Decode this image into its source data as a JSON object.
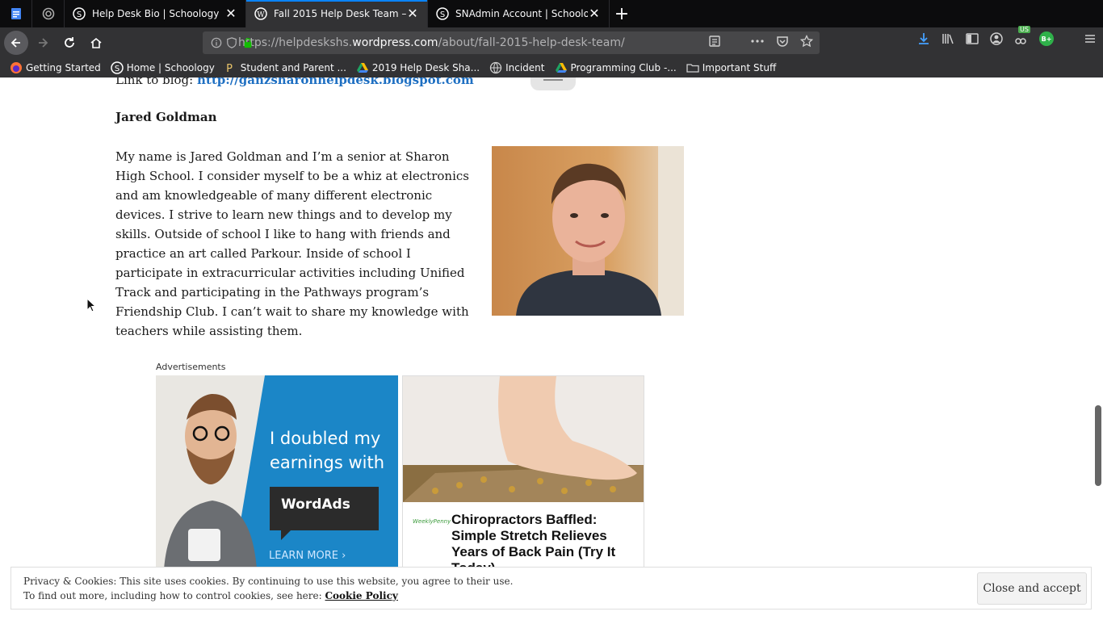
{
  "tabs": [
    {
      "title": "Help Desk Bio | Schoology",
      "active": false
    },
    {
      "title": "Fall 2015 Help Desk Team – SH",
      "active": true
    },
    {
      "title": "SNAdmin Account | Schoology",
      "active": false
    }
  ],
  "url": {
    "prefix": "https://helpdeskshs.",
    "domain": "wordpress.com",
    "path": "/about/fall-2015-help-desk-team/"
  },
  "bookmarks": [
    {
      "label": "Getting Started",
      "icon": "firefox-icon"
    },
    {
      "label": "Home | Schoology",
      "icon": "schoology-icon"
    },
    {
      "label": "Student and Parent ...",
      "icon": "p-icon"
    },
    {
      "label": "2019 Help Desk Sha...",
      "icon": "drive-icon"
    },
    {
      "label": "Incident",
      "icon": "globe-icon"
    },
    {
      "label": "Programming Club -...",
      "icon": "drive-icon"
    },
    {
      "label": "Important Stuff",
      "icon": "folder-icon"
    }
  ],
  "toolbar_badges": {
    "us": "US",
    "bplus": "B+"
  },
  "content": {
    "blog_label": "Link to blog:",
    "blog_url": "http://ganzsharonhelpdesk.blogspot.com",
    "name": "Jared Goldman",
    "bio": "My name is Jared Goldman and I’m a senior at Sharon High School. I consider myself to be a whiz at electronics and am knowledgeable of many different electronic devices. I strive to learn new things and to develop my skills. Outside of school I like to hang with friends and practice an art called Parkour. Inside of school I participate in extracurricular activities including Unified Track and participating in the Pathways program’s Friendship Club. I can’t wait to share my knowledge with teachers while assisting them."
  },
  "ads": {
    "label": "Advertisements",
    "ad1": {
      "text": "I doubled my earnings with",
      "brand": "WordAds",
      "cta": "LEARN MORE ›"
    },
    "ad2": {
      "logo": "WeeklyPenny",
      "headline": "Chiropractors Baffled: Simple Stretch Relieves Years of Back Pain (Try It Today)"
    }
  },
  "cookie": {
    "line1": "Privacy & Cookies: This site uses cookies. By continuing to use this website, you agree to their use.",
    "line2": "To find out more, including how to control cookies, see here:",
    "link": "Cookie Policy",
    "button": "Close and accept"
  },
  "colors": {
    "accent": "#0a84ff",
    "link": "#1e6fc2",
    "ad_blue": "#1b86c7"
  }
}
